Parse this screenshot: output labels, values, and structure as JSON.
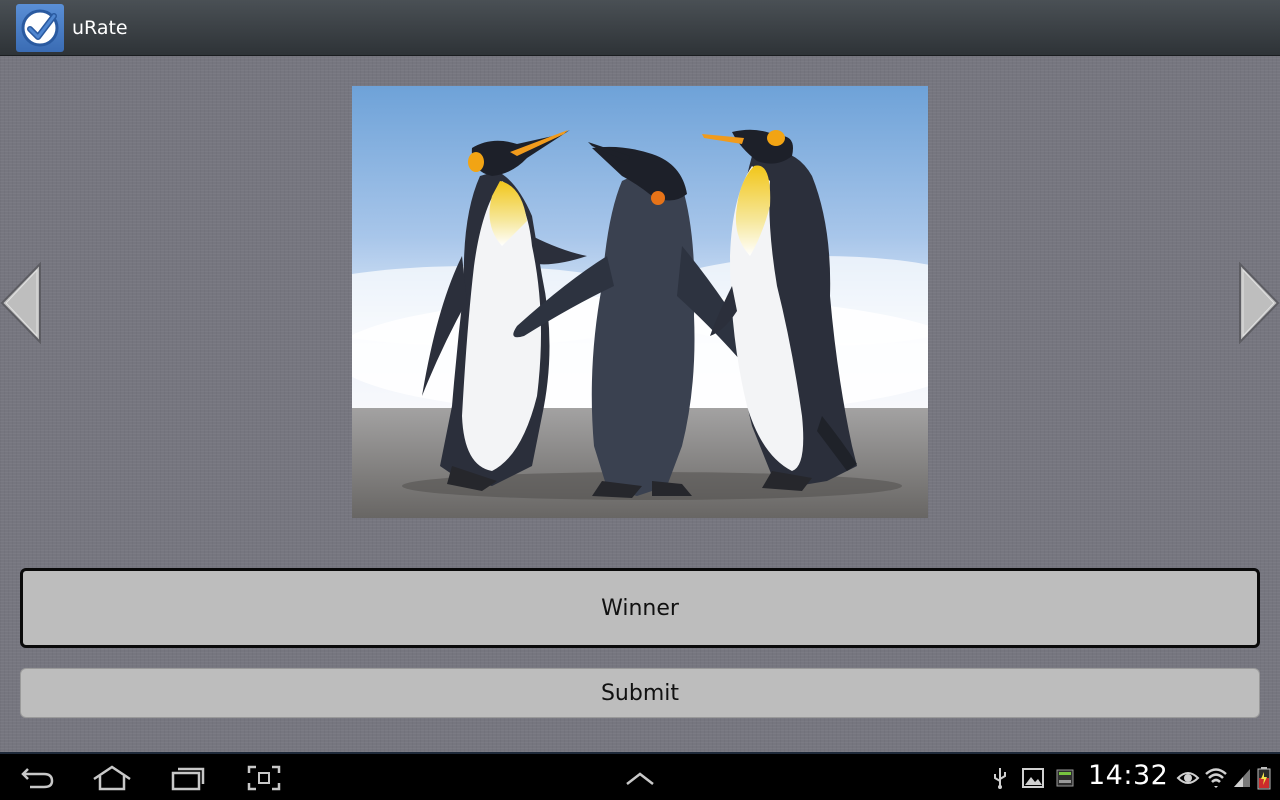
{
  "app": {
    "title": "uRate",
    "icon": "checkmark-icon"
  },
  "photo": {
    "subject": "penguins-photo"
  },
  "buttons": {
    "winner_label": "Winner",
    "submit_label": "Submit"
  },
  "navigation": {
    "previous_icon": "triangle-left-icon",
    "next_icon": "triangle-right-icon"
  },
  "system_bar": {
    "clock": "14:32",
    "nav_icons": [
      "back-icon",
      "home-icon",
      "recent-apps-icon",
      "screenshot-icon",
      "chevron-up-icon"
    ],
    "status_icons": [
      "usb-icon",
      "gallery-icon",
      "3g-icon",
      "eye-icon",
      "wifi-icon",
      "signal-icon",
      "battery-icon"
    ]
  },
  "colors": {
    "action_bar": "#3b4045",
    "content_bg": "#76767f",
    "button_bg": "#bdbdbd",
    "app_icon": "#4a7dc4"
  }
}
